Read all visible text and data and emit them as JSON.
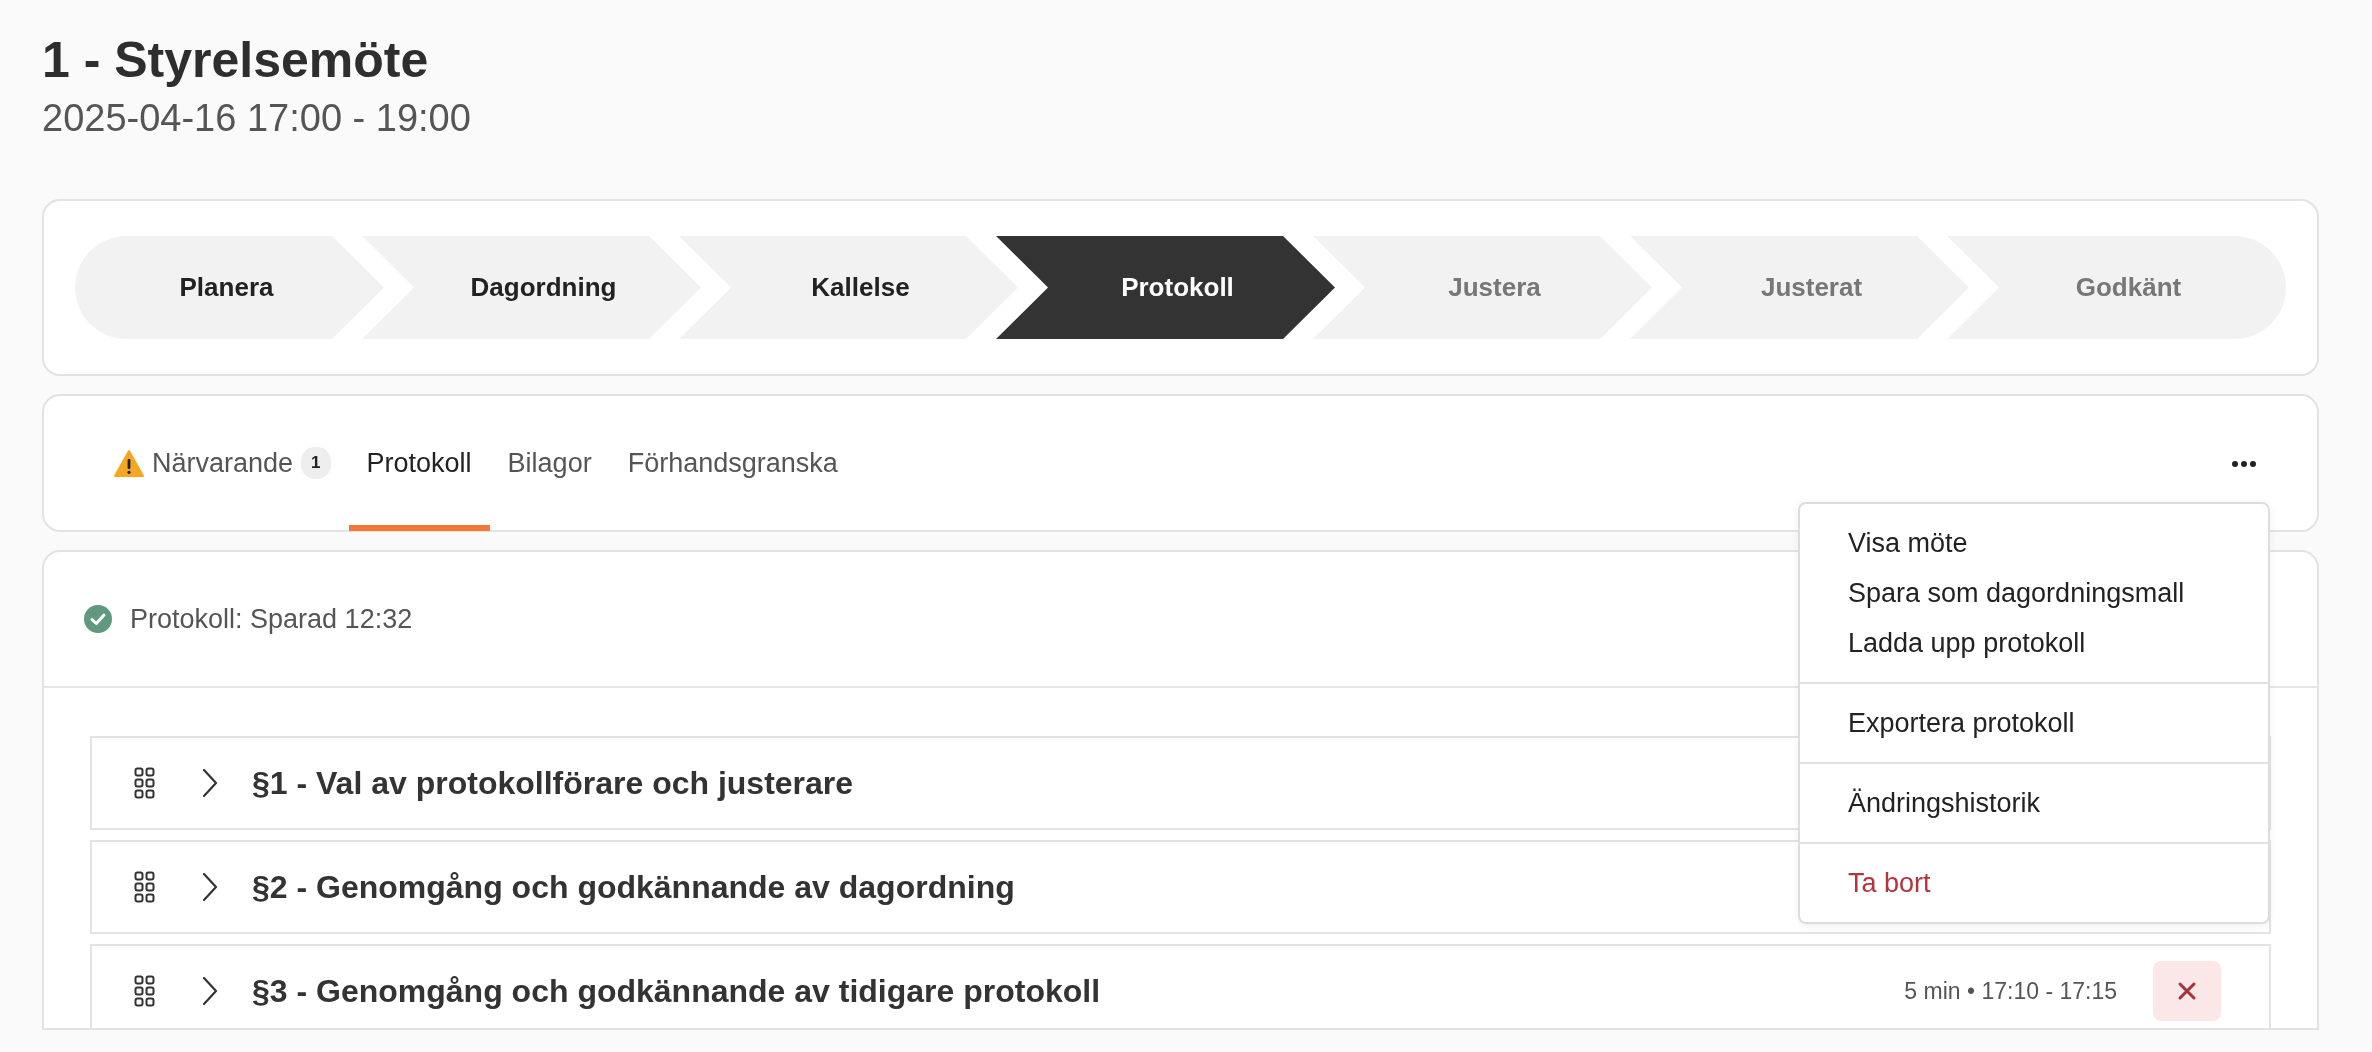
{
  "header": {
    "title": "1 - Styrelsemöte",
    "subtitle": "2025-04-16 17:00 - 19:00"
  },
  "steps": [
    {
      "label": "Planera",
      "selected": false,
      "reached": true
    },
    {
      "label": "Dagordning",
      "selected": false,
      "reached": true
    },
    {
      "label": "Kallelse",
      "selected": false,
      "reached": true
    },
    {
      "label": "Protokoll",
      "selected": true,
      "reached": true
    },
    {
      "label": "Justera",
      "selected": false,
      "reached": false
    },
    {
      "label": "Justerat",
      "selected": false,
      "reached": false
    },
    {
      "label": "Godkänt",
      "selected": false,
      "reached": false
    }
  ],
  "tabs": [
    {
      "label": "Närvarande",
      "selected": false,
      "warning": true,
      "count": "1"
    },
    {
      "label": "Protokoll",
      "selected": true,
      "warning": false
    },
    {
      "label": "Bilagor",
      "selected": false,
      "warning": false
    },
    {
      "label": "Förhandsgranska",
      "selected": false,
      "warning": false
    }
  ],
  "status": {
    "text": "Protokoll: Sparad 12:32",
    "saved": true
  },
  "agenda_items": [
    {
      "title": "§1 - Val av protokollförare och justerare"
    },
    {
      "title": "§2 - Genomgång och godkännande av dagordning"
    },
    {
      "title": "§3 - Genomgång och godkännande av tidigare protokoll",
      "meta": "5 min • 17:10 - 17:15",
      "deletable": true
    }
  ],
  "menu": {
    "expanded": true,
    "groups": [
      [
        {
          "label": "Visa möte",
          "kind": "normal"
        },
        {
          "label": "Spara som dagordningsmall",
          "kind": "normal"
        },
        {
          "label": "Ladda upp protokoll",
          "kind": "normal"
        }
      ],
      [
        {
          "label": "Exportera protokoll",
          "kind": "normal"
        }
      ],
      [
        {
          "label": "Ändringshistorik",
          "kind": "normal"
        }
      ],
      [
        {
          "label": "Ta bort",
          "kind": "danger"
        }
      ]
    ]
  }
}
